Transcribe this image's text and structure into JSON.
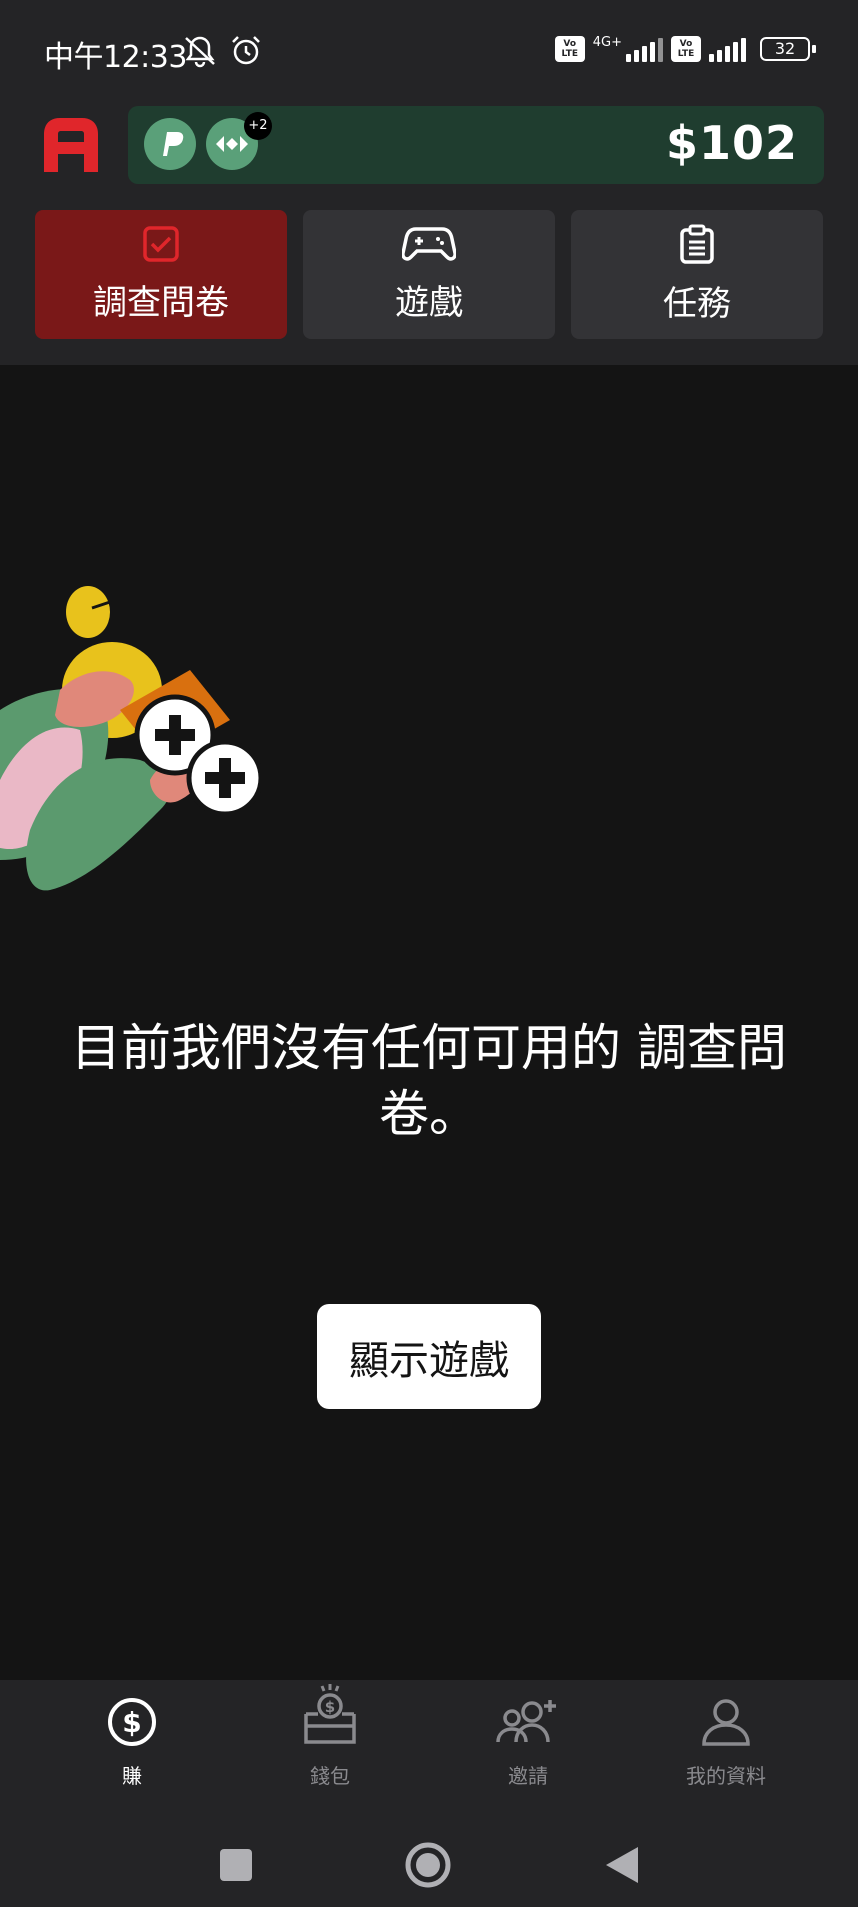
{
  "status_bar": {
    "time": "中午12:33",
    "network": "4G+",
    "volte_label": "Vo LTE",
    "battery": "32"
  },
  "header": {
    "logo": "A",
    "balance": "$102",
    "payment_methods": [
      "paypal-icon",
      "swap-icon"
    ],
    "more_methods_badge": "+2",
    "tabs": [
      {
        "label": "調查問卷",
        "icon": "checkbox-icon",
        "active": true
      },
      {
        "label": "遊戲",
        "icon": "gamepad-icon",
        "active": false
      },
      {
        "label": "任務",
        "icon": "clipboard-icon",
        "active": false
      }
    ]
  },
  "main": {
    "empty_message_prefix": "目前我們沒有任何可用的",
    "empty_message_highlight": "調查問卷",
    "empty_message_suffix": "。",
    "show_games_button": "顯示遊戲"
  },
  "bottom_nav": {
    "items": [
      {
        "label": "賺",
        "icon": "dollar-icon",
        "active": true
      },
      {
        "label": "錢包",
        "icon": "wallet-icon",
        "active": false
      },
      {
        "label": "邀請",
        "icon": "invite-users-icon",
        "active": false
      },
      {
        "label": "我的資料",
        "icon": "profile-icon",
        "active": false
      }
    ]
  },
  "colors": {
    "active_tab": "#7a1818",
    "balance_card": "#1f3d2f",
    "brand_red": "#e0262b"
  }
}
